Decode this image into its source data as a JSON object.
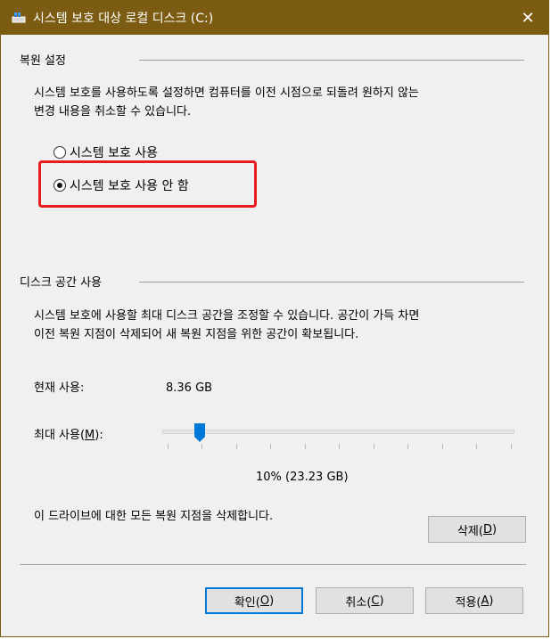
{
  "window": {
    "title": "시스템 보호 대상 로컬 디스크 (C:)",
    "close_glyph": "✕"
  },
  "restore_settings": {
    "group_label": "복원 설정",
    "description_line1": "시스템 보호를 사용하도록 설정하면 컴퓨터를 이전 시점으로 되돌려 원하지 않는",
    "description_line2": "변경 내용을 취소할 수 있습니다.",
    "options": [
      {
        "label": "시스템 보호 사용",
        "selected": false
      },
      {
        "label": "시스템 보호 사용 안 함",
        "selected": true
      }
    ]
  },
  "disk_space": {
    "group_label": "디스크 공간 사용",
    "description_line1": "시스템 보호에 사용할 최대 디스크 공간을 조정할 수 있습니다. 공간이 가득 차면",
    "description_line2": "이전 복원 지점이 삭제되어 새 복원 지점을 위한 공간이 확보됩니다.",
    "current_usage_label": "현재 사용:",
    "current_usage_value": "8.36 GB",
    "max_usage_label": "최대 사용(",
    "max_usage_mnemonic": "M",
    "max_usage_label_end": "):",
    "slider_percent": 10,
    "slider_value_text": "10% (23.23 GB)",
    "delete_text": "이 드라이브에 대한 모든 복원 지점을 삭제합니다.",
    "delete_button": {
      "label": "삭제(",
      "mnemonic": "D",
      "label_end": ")"
    }
  },
  "buttons": {
    "ok": {
      "label": "확인(",
      "mnemonic": "O",
      "label_end": ")"
    },
    "cancel": {
      "label": "취소(",
      "mnemonic": "C",
      "label_end": ")"
    },
    "apply": {
      "label": "적용(",
      "mnemonic": "A",
      "label_end": ")"
    }
  },
  "colors": {
    "titlebar": "#7b5c12",
    "highlight": "#e81c1c",
    "slider_thumb": "#0078d7"
  }
}
